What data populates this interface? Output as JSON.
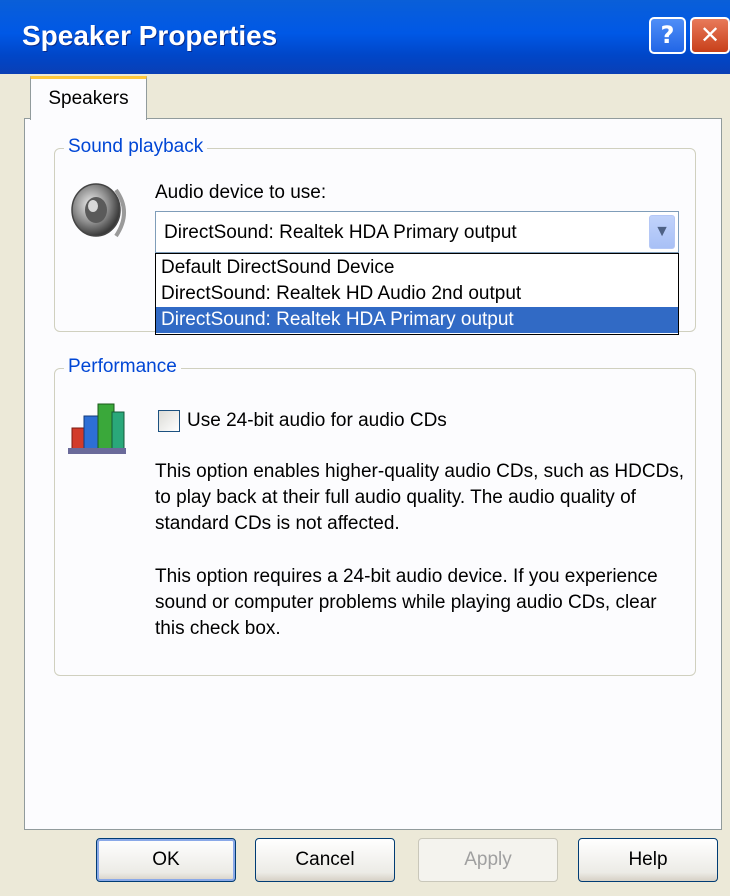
{
  "window": {
    "title": "Speaker Properties",
    "help_glyph": "?",
    "close_glyph": "✕"
  },
  "tabs": [
    {
      "label": "Speakers",
      "active": true
    }
  ],
  "sound_playback": {
    "legend": "Sound playback",
    "icon": "speaker-icon",
    "device_label": "Audio device to use:",
    "selected_device": "DirectSound: Realtek HDA Primary output",
    "options": [
      "Default DirectSound Device",
      "DirectSound: Realtek HD Audio 2nd output",
      "DirectSound: Realtek HDA Primary output"
    ],
    "highlighted_option_index": 2
  },
  "performance": {
    "legend": "Performance",
    "icon": "performance-icon",
    "checkbox_label": "Use 24-bit audio for audio CDs",
    "checkbox_checked": false,
    "paragraph1": "This option enables higher-quality audio CDs, such as HDCDs, to play back at their full audio quality. The audio quality of standard CDs is not affected.",
    "paragraph2": "This option requires a 24-bit audio device. If you experience sound or computer problems while playing audio CDs, clear this check box."
  },
  "buttons": {
    "ok": "OK",
    "cancel": "Cancel",
    "apply": "Apply",
    "help": "Help"
  },
  "colors": {
    "titlebar": "#0058e6",
    "legend_text": "#0046d5",
    "selection": "#316ac5",
    "dialog_bg": "#ece9d8"
  }
}
